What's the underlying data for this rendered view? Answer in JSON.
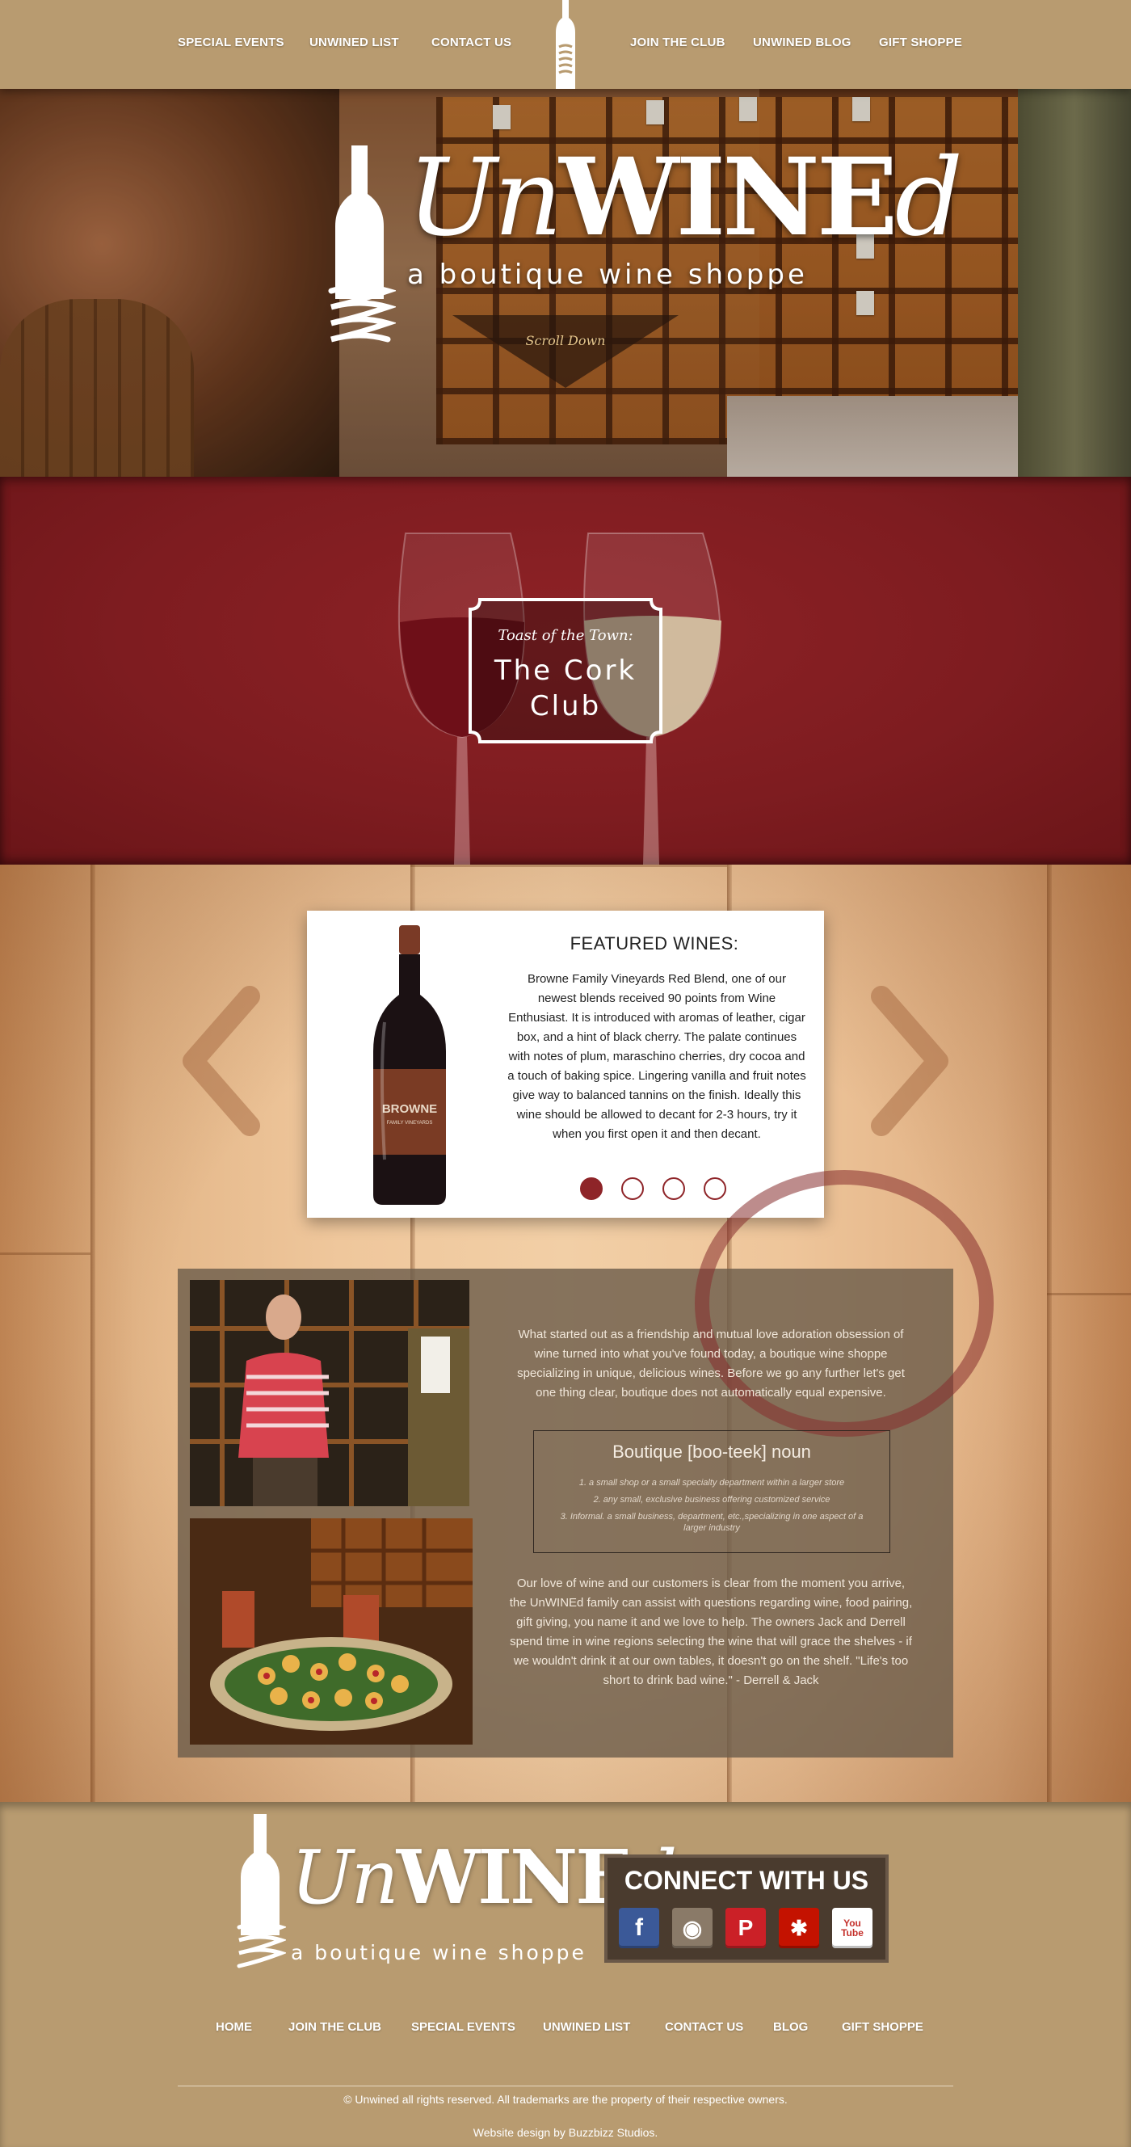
{
  "nav": {
    "left": [
      "SPECIAL EVENTS",
      "UNWINED LIST",
      "CONTACT US"
    ],
    "right": [
      "JOIN THE CLUB",
      "UNWINED BLOG",
      "GIFT SHOPPE"
    ]
  },
  "hero": {
    "brand_un": "Un",
    "brand_wine": "WINE",
    "brand_d": "d",
    "tagline": "a boutique wine shoppe",
    "scroll": "Scroll Down"
  },
  "club": {
    "toast": "Toast of the Town:",
    "name": "The Cork Club"
  },
  "featured": {
    "title": "FEATURED WINES:",
    "description": "Browne Family Vineyards Red Blend, one of our newest blends received 90 points from Wine Enthusiast. It is introduced with aromas of leather, cigar box, and a hint of black cherry. The palate continues with notes of plum, maraschino cherries, dry cocoa and a touch of baking spice. Lingering vanilla and fruit notes give way to balanced tannins on the finish. Ideally this wine should be allowed to decant for 2-3 hours, try it when you first open it and then decant.",
    "label_brand": "BROWNE",
    "label_sub": "FAMILY VINEYARDS",
    "slides": 4,
    "active_slide": 1
  },
  "about": {
    "intro": "What started out as a friendship and mutual love adoration obsession of wine turned into what you've found today, a boutique wine shoppe specializing in unique, delicious wines. Before we go any further let's get one thing clear, boutique does not automatically equal expensive.",
    "definition_title": "Boutique [boo-teek] noun",
    "definitions": [
      "1. a small shop or a small specialty department within a larger store",
      "2. any small, exclusive business offering customized service",
      "3. Informal. a small business, department, etc.,specializing in one aspect of a larger industry"
    ],
    "closing": "Our love of wine and our customers is clear from the moment you arrive, the UnWINEd family can assist with questions regarding wine, food pairing, gift giving, you name it and we love to help. The owners Jack and Derrell spend time in wine regions selecting the wine that will grace the shelves - if we wouldn't drink it at our own tables, it doesn't go on the shelf. \"Life's too short to drink bad wine.\" - Derrell & Jack"
  },
  "footer": {
    "brand_un": "Un",
    "brand_wine": "WINE",
    "brand_d": "d",
    "tagline": "a boutique wine shoppe",
    "connect_title": "CONNECT WITH US",
    "social": [
      {
        "name": "facebook-icon",
        "glyph": "f",
        "color": "#3b5998"
      },
      {
        "name": "instagram-icon",
        "glyph": "◉",
        "color": "#8a7a68"
      },
      {
        "name": "pinterest-icon",
        "glyph": "P",
        "color": "#cb2027"
      },
      {
        "name": "yelp-icon",
        "glyph": "✱",
        "color": "#c41200"
      },
      {
        "name": "youtube-icon",
        "glyph": "You Tube",
        "color": "#ffffff"
      }
    ],
    "nav": [
      "HOME",
      "JOIN THE CLUB",
      "SPECIAL EVENTS",
      "UNWINED LIST",
      "CONTACT US",
      "BLOG",
      "GIFT SHOPPE"
    ],
    "copyright": "© Unwined all rights reserved. All trademarks are the property of their respective owners.",
    "credit": "Website design by Buzzbizz Studios."
  },
  "colors": {
    "accent_red": "#8e2428",
    "tan": "#b89b70"
  }
}
